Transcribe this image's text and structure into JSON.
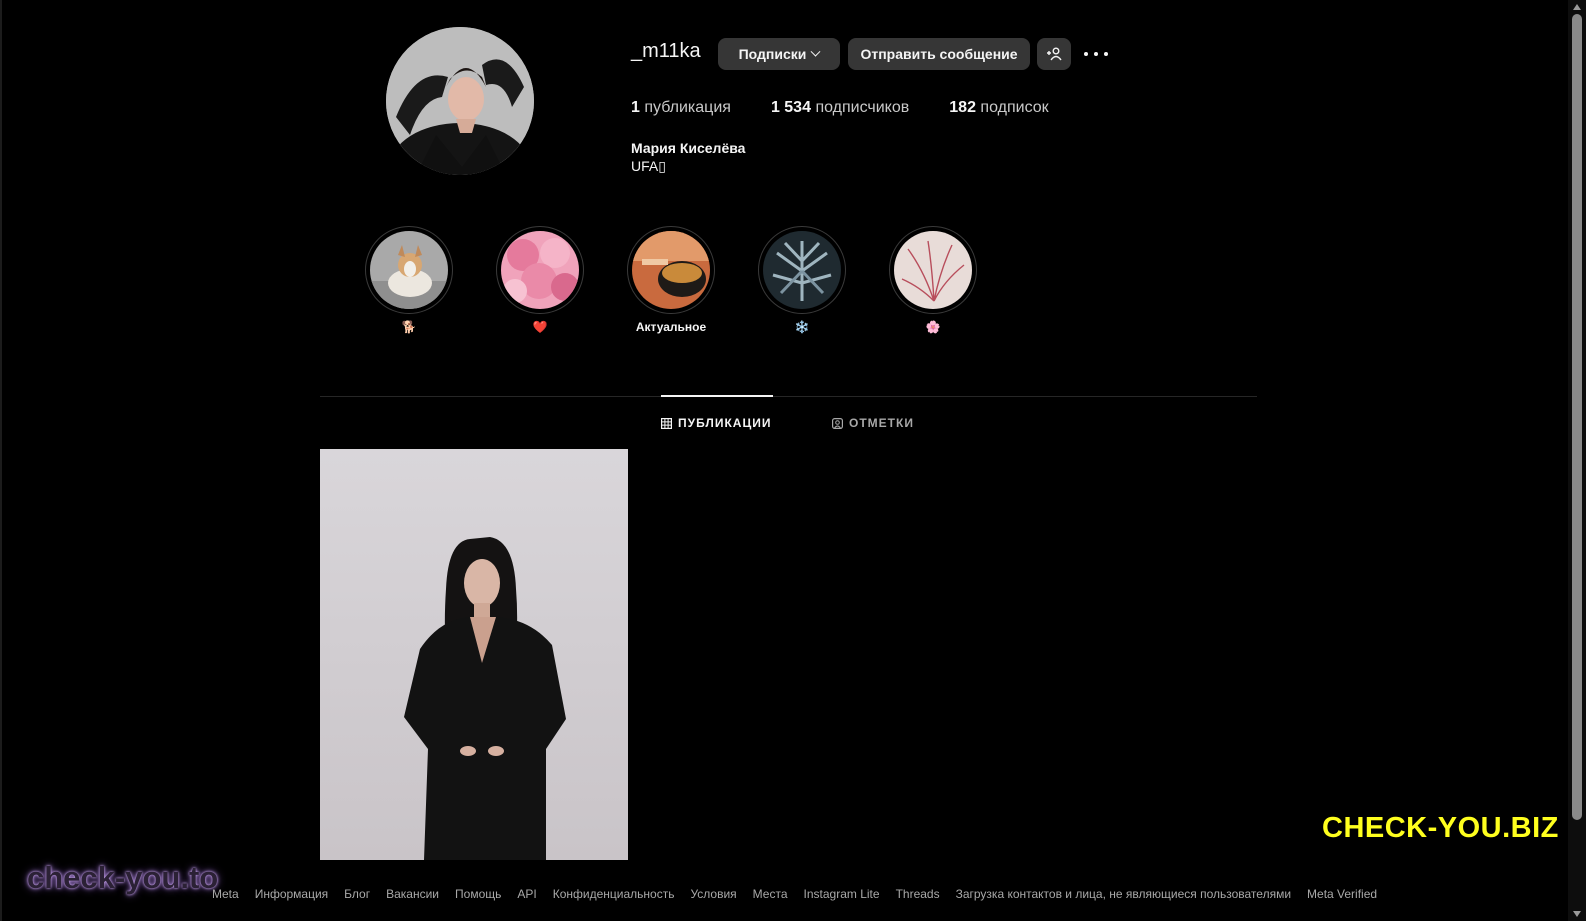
{
  "profile": {
    "username": "_m11ka",
    "following_button": "Подписки",
    "message_button": "Отправить сообщение",
    "add_user_icon": "person-plus-icon",
    "more_icon": "ellipsis-icon",
    "stats": {
      "posts_count": "1",
      "posts_label": "публикация",
      "followers_count": "1 534",
      "followers_label": "подписчиков",
      "following_count": "182",
      "following_label": "подписок"
    },
    "full_name": "Мария Киселёва",
    "bio": "UFA▯"
  },
  "highlights": [
    {
      "label": "🐕"
    },
    {
      "label": "❤️"
    },
    {
      "label": "Актуальное"
    },
    {
      "label": "❄️"
    },
    {
      "label": "🌸"
    }
  ],
  "tabs": {
    "posts": "ПУБЛИКАЦИИ",
    "tagged": "ОТМЕТКИ",
    "active": "posts"
  },
  "watermarks": {
    "biz": "CHECK-YOU.BIZ",
    "to": "check-you.to"
  },
  "footer": {
    "links": [
      "Meta",
      "Информация",
      "Блог",
      "Вакансии",
      "Помощь",
      "API",
      "Конфиденциальность",
      "Условия",
      "Места",
      "Instagram Lite",
      "Threads",
      "Загрузка контактов и лица, не являющиеся пользователями",
      "Meta Verified"
    ]
  }
}
